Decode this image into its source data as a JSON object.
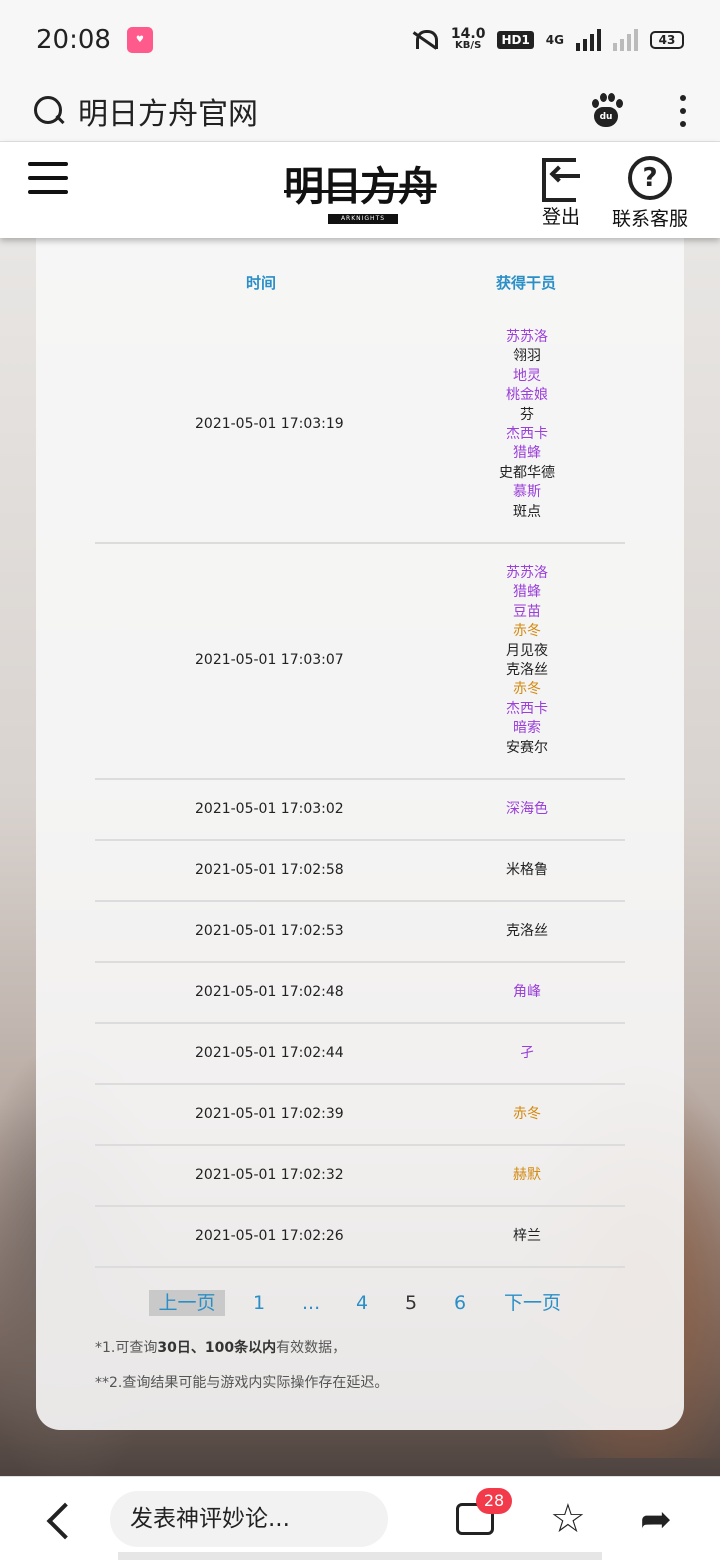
{
  "status_bar": {
    "time": "20:08",
    "net_speed": "14.0",
    "net_speed_unit": "KB/S",
    "hd_label": "HD1",
    "signal_label": "4G",
    "battery": "43"
  },
  "browser": {
    "search_text": "明日方舟官网"
  },
  "site_header": {
    "logo_text": "明日方舟",
    "logo_sub": "ARKNIGHTS",
    "logout_label": "登出",
    "support_label": "联系客服"
  },
  "table": {
    "headers": {
      "time": "时间",
      "operators": "获得干员"
    },
    "rows": [
      {
        "time": "2021-05-01 17:03:19",
        "operators": [
          {
            "name": "苏苏洛",
            "rarity": "purple"
          },
          {
            "name": "翎羽",
            "rarity": "black"
          },
          {
            "name": "地灵",
            "rarity": "purple"
          },
          {
            "name": "桃金娘",
            "rarity": "purple"
          },
          {
            "name": "芬",
            "rarity": "black"
          },
          {
            "name": "杰西卡",
            "rarity": "purple"
          },
          {
            "name": "猎蜂",
            "rarity": "purple"
          },
          {
            "name": "史都华德",
            "rarity": "black"
          },
          {
            "name": "慕斯",
            "rarity": "purple"
          },
          {
            "name": "斑点",
            "rarity": "black"
          }
        ]
      },
      {
        "time": "2021-05-01 17:03:07",
        "operators": [
          {
            "name": "苏苏洛",
            "rarity": "purple"
          },
          {
            "name": "猎蜂",
            "rarity": "purple"
          },
          {
            "name": "豆苗",
            "rarity": "purple"
          },
          {
            "name": "赤冬",
            "rarity": "gold"
          },
          {
            "name": "月见夜",
            "rarity": "black"
          },
          {
            "name": "克洛丝",
            "rarity": "black"
          },
          {
            "name": "赤冬",
            "rarity": "gold"
          },
          {
            "name": "杰西卡",
            "rarity": "purple"
          },
          {
            "name": "暗索",
            "rarity": "purple"
          },
          {
            "name": "安赛尔",
            "rarity": "black"
          }
        ]
      },
      {
        "time": "2021-05-01 17:03:02",
        "operators": [
          {
            "name": "深海色",
            "rarity": "purple"
          }
        ]
      },
      {
        "time": "2021-05-01 17:02:58",
        "operators": [
          {
            "name": "米格鲁",
            "rarity": "black"
          }
        ]
      },
      {
        "time": "2021-05-01 17:02:53",
        "operators": [
          {
            "name": "克洛丝",
            "rarity": "black"
          }
        ]
      },
      {
        "time": "2021-05-01 17:02:48",
        "operators": [
          {
            "name": "角峰",
            "rarity": "purple"
          }
        ]
      },
      {
        "time": "2021-05-01 17:02:44",
        "operators": [
          {
            "name": "孑",
            "rarity": "purple"
          }
        ]
      },
      {
        "time": "2021-05-01 17:02:39",
        "operators": [
          {
            "name": "赤冬",
            "rarity": "gold"
          }
        ]
      },
      {
        "time": "2021-05-01 17:02:32",
        "operators": [
          {
            "name": "赫默",
            "rarity": "gold"
          }
        ]
      },
      {
        "time": "2021-05-01 17:02:26",
        "operators": [
          {
            "name": "梓兰",
            "rarity": "black"
          }
        ]
      }
    ]
  },
  "pagination": {
    "prev": "上一页",
    "first": "1",
    "ellipsis": "...",
    "p4": "4",
    "current": "5",
    "p6": "6",
    "next": "下一页"
  },
  "notes": {
    "note1_prefix": "*1.可查询",
    "note1_bold": "30日、100条以内",
    "note1_suffix": "有效数据，",
    "note2": "**2.查询结果可能与游戏内实际操作存在延迟。"
  },
  "bottom_bar": {
    "comment_placeholder": "发表神评妙论...",
    "comment_count": "28"
  },
  "colors": {
    "purple": "#9a3fd9",
    "gold": "#d48a12",
    "black": "#222222",
    "header_blue": "#2a8fc7"
  }
}
